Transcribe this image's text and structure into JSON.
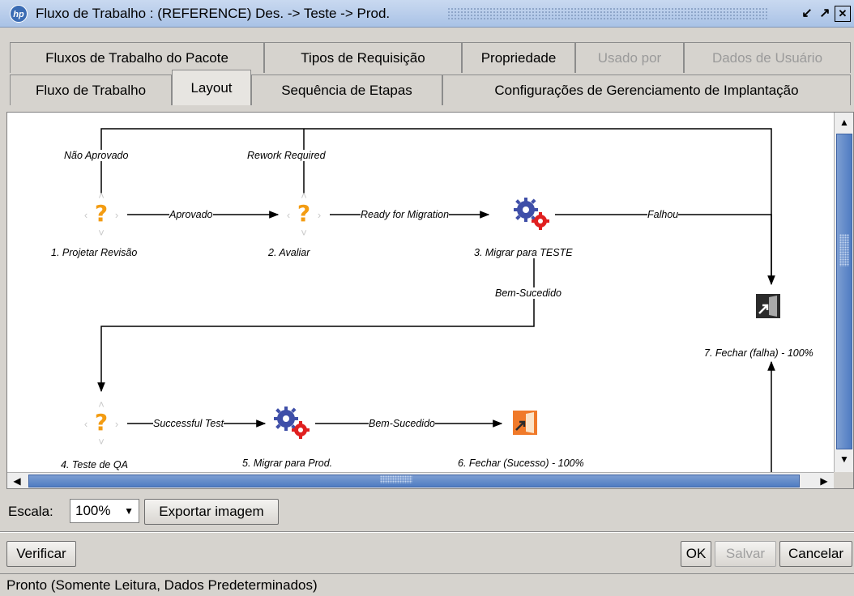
{
  "window": {
    "title": "Fluxo de Trabalho : (REFERENCE) Des. -> Teste -> Prod.",
    "logo_text": "hp",
    "buttons": [
      "restore",
      "maximize",
      "close"
    ]
  },
  "tabs": {
    "row1": [
      {
        "label": "Fluxos de Trabalho do Pacote",
        "enabled": true
      },
      {
        "label": "Tipos de Requisição",
        "enabled": true
      },
      {
        "label": "Propriedade",
        "enabled": true
      },
      {
        "label": "Usado por",
        "enabled": false
      },
      {
        "label": "Dados de Usuário",
        "enabled": false
      }
    ],
    "row2": [
      {
        "label": "Fluxo de Trabalho",
        "enabled": true
      },
      {
        "label": "Layout",
        "enabled": true,
        "active": true
      },
      {
        "label": "Sequência de Etapas",
        "enabled": true
      },
      {
        "label": "Configurações de Gerenciamento de Implantação",
        "enabled": true
      }
    ]
  },
  "workflow": {
    "steps": [
      {
        "id": 1,
        "label": "1. Projetar Revisão",
        "icon": "decision-icon"
      },
      {
        "id": 2,
        "label": "2. Avaliar",
        "icon": "decision-icon"
      },
      {
        "id": 3,
        "label": "3. Migrar para TESTE",
        "icon": "execution-gears-icon"
      },
      {
        "id": 4,
        "label": "4. Teste de QA",
        "icon": "decision-icon"
      },
      {
        "id": 5,
        "label": "5. Migrar para Prod.",
        "icon": "execution-gears-icon"
      },
      {
        "id": 6,
        "label": "6. Fechar (Sucesso) - 100%",
        "icon": "close-success-icon"
      },
      {
        "id": 7,
        "label": "7. Fechar (falha) - 100%",
        "icon": "close-failure-icon"
      }
    ],
    "transitions": {
      "aprovado": "Aprovado",
      "nao_aprovado": "Não Aprovado",
      "rework": "Rework Required",
      "ready": "Ready for Migration",
      "falhou": "Falhou",
      "bem_sucedido_1": "Bem-Sucedido",
      "successful_test": "Successful Test",
      "bem_sucedido_2": "Bem-Sucedido"
    }
  },
  "scale": {
    "label": "Escala:",
    "value": "100%",
    "export_label": "Exportar imagem"
  },
  "actions": {
    "verify": "Verificar",
    "ok": "OK",
    "save": "Salvar",
    "cancel": "Cancelar"
  },
  "status": "Pronto (Somente Leitura, Dados Predeterminados)",
  "colors": {
    "accent": "#4f7cc2",
    "decision": "#f39c12",
    "gear_blue": "#3f4fa8",
    "gear_red": "#e02020",
    "close_orange": "#f07a2a",
    "close_dark": "#2b2b2b"
  }
}
